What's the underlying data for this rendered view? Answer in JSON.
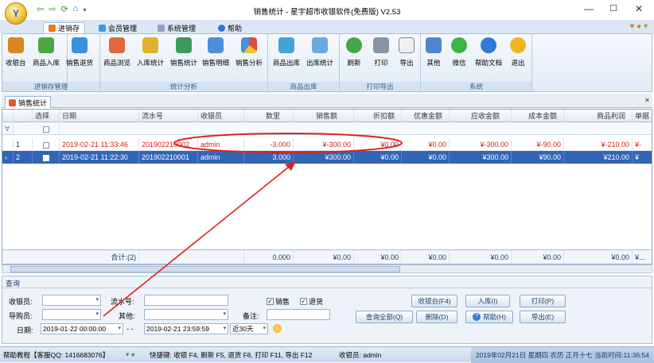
{
  "app": {
    "title": "销售统计 - 星宇超市收银软件(免费版) V2.53",
    "orb": "Y"
  },
  "tabs": [
    {
      "label": "进销存"
    },
    {
      "label": "会员管理"
    },
    {
      "label": "系统管理"
    },
    {
      "label": "帮助"
    }
  ],
  "ribbon": {
    "groups": [
      {
        "label": "进销存管理",
        "buttons": [
          "收银台",
          "商品入库",
          "销售退货"
        ]
      },
      {
        "label": "统计分析",
        "buttons": [
          "商品浏览",
          "入库统计",
          "销售统计",
          "销售明细",
          "销售分析"
        ]
      },
      {
        "label": "商品出库",
        "buttons": [
          "商品出库",
          "出库统计"
        ]
      },
      {
        "label": "打印导出",
        "buttons": [
          "刷新",
          "打印",
          "导出"
        ]
      },
      {
        "label": "系统",
        "buttons": [
          "其他",
          "微信",
          "帮助文档",
          "退出"
        ]
      }
    ]
  },
  "doc_tab": {
    "label": "销售统计"
  },
  "grid": {
    "columns": [
      "选择",
      "日期",
      "流水号",
      "收银员",
      "数里",
      "销售额",
      "折扣额",
      "优惠金额",
      "应收金额",
      "成本金额",
      "商品利润",
      "单据"
    ],
    "rows": [
      {
        "num": "1",
        "date": "2019-02-21 11:33:46",
        "serial": "201902210002",
        "cashier": "admin",
        "qty": "-3.000",
        "sales": "¥-300.00",
        "discount": "¥0.00",
        "promo": "¥0.00",
        "receivable": "¥-300.00",
        "cost": "¥-90.00",
        "profit": "¥-210.00",
        "doc": "¥-"
      },
      {
        "num": "2",
        "date": "2019-02-21 11:22:30",
        "serial": "201902210001",
        "cashier": "admin",
        "qty": "3.000",
        "sales": "¥300.00",
        "discount": "¥0.00",
        "promo": "¥0.00",
        "receivable": "¥300.00",
        "cost": "¥90.00",
        "profit": "¥210.00",
        "doc": "¥"
      }
    ],
    "total": {
      "label": "合计:(2)",
      "qty": "0.000",
      "sales": "¥0.00",
      "discount": "¥0.00",
      "promo": "¥0.00",
      "receivable": "¥0.00",
      "cost": "¥0.00",
      "profit": "¥0.00",
      "doc": "¥..."
    }
  },
  "query": {
    "header": "查询",
    "cashier_label": "收银员:",
    "serial_label": "流水号:",
    "guide_label": "导购员:",
    "other_label": "其他:",
    "remark_label": "备注:",
    "date_label": "日期:",
    "date_from": "2019-01-22 00:00:00",
    "date_to": "2019-02-21 23:59:59",
    "range": "近30天",
    "dash": "- -",
    "chk_sales": "销售",
    "chk_return": "退货",
    "buttons": {
      "cashier": "收银台(F4)",
      "stock_in": "入库(I)",
      "print": "打印(P)",
      "query_all": "查询全部(Q)",
      "delete": "删除(D)",
      "help": "帮助(H)",
      "export": "导出(E)"
    }
  },
  "status": {
    "help": "帮助教程【客服QQ: 1416683076】",
    "shortcuts": "快捷键: 收银 F4, 刷新 F5, 退货 F6, 打印 F11, 导出 F12",
    "cashier": "收银员: admin",
    "datetime": "2019年02月21日 星期四 农历 正月十七 当前时间:11:36:54"
  },
  "colors": {
    "selected_row": "#3365b5",
    "negative_text": "#d41f1f",
    "annotation": "#e02020"
  }
}
